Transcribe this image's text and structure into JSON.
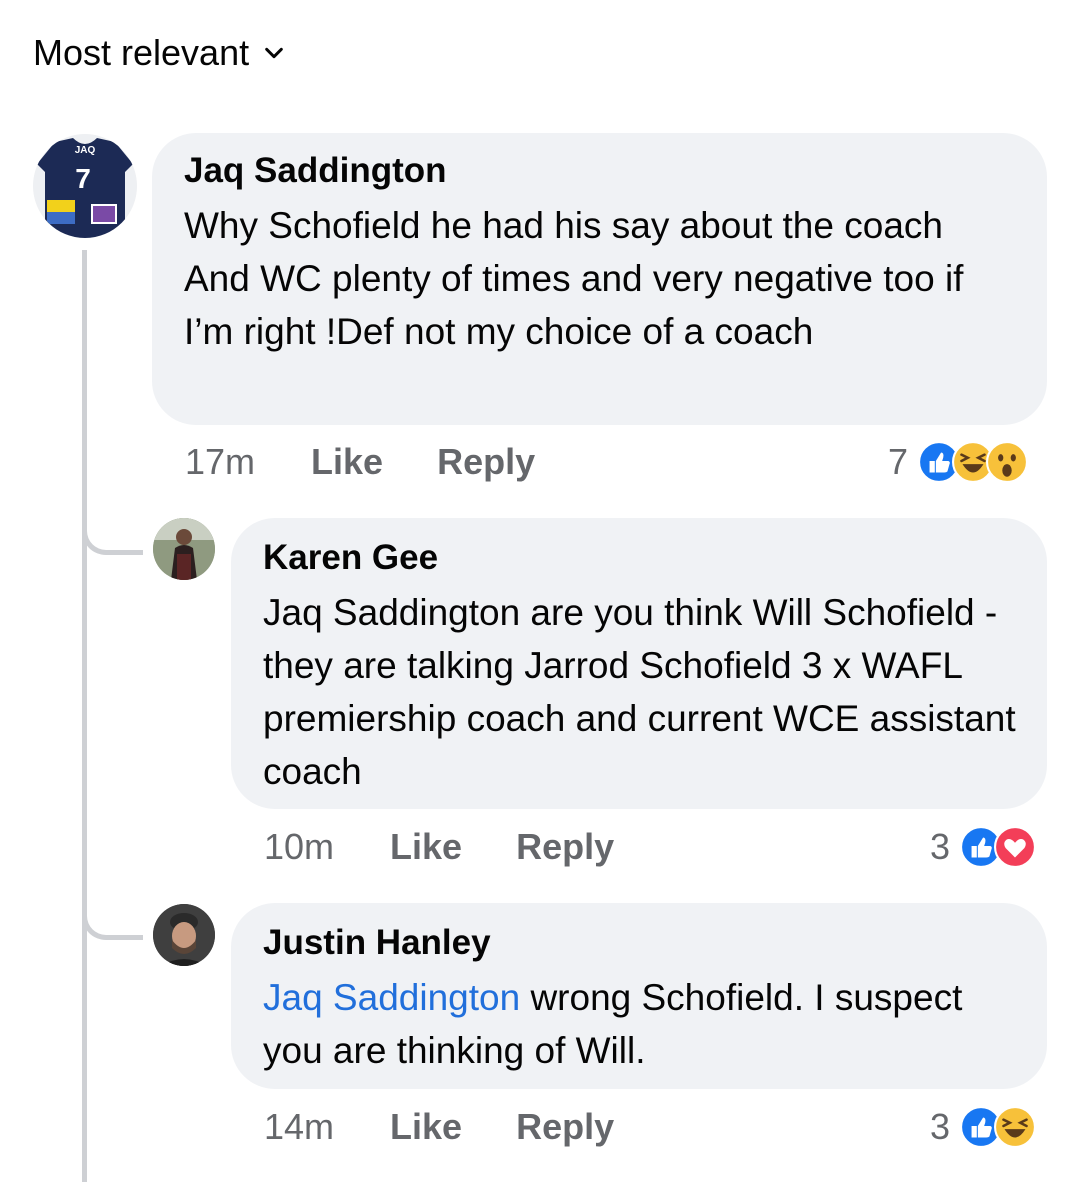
{
  "sort": {
    "label": "Most relevant"
  },
  "comments": [
    {
      "author": "Jaq Saddington",
      "text": "Why Schofield he had his say about the coach And WC plenty of times and very negative too if I’m right !Def not my choice of a coach",
      "time": "17m",
      "like_label": "Like",
      "reply_label": "Reply",
      "reaction_count": "7",
      "reactions": [
        "like-icon",
        "haha-icon",
        "wow-icon"
      ],
      "jersey_text": "JAQ",
      "jersey_number": "7"
    },
    {
      "author": "Karen Gee",
      "text": "Jaq Saddington are you think Will Schofield - they are talking Jarrod Schofield 3 x WAFL premiership coach and current WCE assistant coach",
      "time": "10m",
      "like_label": "Like",
      "reply_label": "Reply",
      "reaction_count": "3",
      "reactions": [
        "like-icon",
        "love-icon"
      ]
    },
    {
      "author": "Justin Hanley",
      "mention": "Jaq Saddington",
      "text": " wrong Schofield. I suspect you are thinking of Will.",
      "time": "14m",
      "like_label": "Like",
      "reply_label": "Reply",
      "reaction_count": "3",
      "reactions": [
        "like-icon",
        "haha-icon"
      ]
    }
  ],
  "colors": {
    "link": "#216fdb",
    "bubble": "#f0f2f5",
    "meta": "#65676b",
    "line": "#ced0d4"
  }
}
